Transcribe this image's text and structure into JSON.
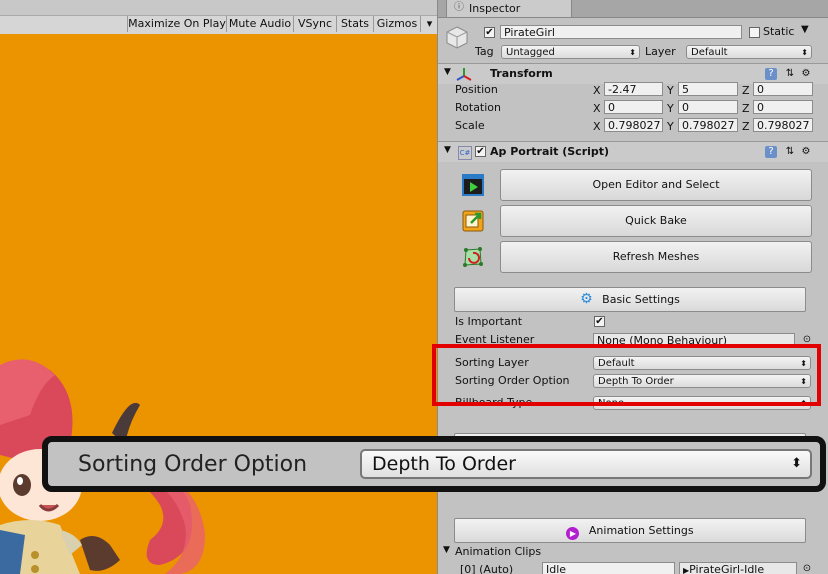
{
  "game_toolbar": {
    "buttons": [
      "Maximize On Play",
      "Mute Audio",
      "VSync",
      "Stats",
      "Gizmos"
    ],
    "gizmos_arrow": "▾"
  },
  "inspector": {
    "tab_label": "Inspector",
    "object": {
      "name": "PirateGirl",
      "static_label": "Static",
      "tag_label": "Tag",
      "tag_value": "Untagged",
      "layer_label": "Layer",
      "layer_value": "Default"
    },
    "transform": {
      "title": "Transform",
      "rows": [
        {
          "label": "Position",
          "x": "-2.47",
          "y": "5",
          "z": "0"
        },
        {
          "label": "Rotation",
          "x": "0",
          "y": "0",
          "z": "0"
        },
        {
          "label": "Scale",
          "x": "0.798027",
          "y": "0.798027",
          "z": "0.798027"
        }
      ],
      "axis": {
        "x": "X",
        "y": "Y",
        "z": "Z"
      }
    },
    "portrait": {
      "title": "Ap Portrait (Script)",
      "buttons": {
        "open_editor": "Open Editor and Select",
        "quick_bake": "Quick Bake",
        "refresh": "Refresh Meshes"
      },
      "basic_settings": "Basic Settings",
      "is_important_label": "Is Important",
      "event_listener_label": "Event Listener",
      "event_listener_value": "None (Mono Behaviour)",
      "sorting_layer_label": "Sorting Layer",
      "sorting_layer_value": "Default",
      "sorting_order_label": "Sorting Order Option",
      "sorting_order_value": "Depth To Order",
      "billboard_label": "Billboard Type",
      "billboard_value": "None",
      "animation_settings": "Animation Settings",
      "animation_clips_label": "Animation Clips",
      "clip_row": {
        "index": "[0] (Auto)",
        "name": "Idle",
        "asset": "PirateGirl-Idle"
      }
    }
  },
  "zoom_callout": {
    "label": "Sorting Order Option",
    "value": "Depth To Order"
  },
  "colors": {
    "game_background": "#ec9400",
    "highlight": "#e20000",
    "callout_border": "#111111"
  }
}
